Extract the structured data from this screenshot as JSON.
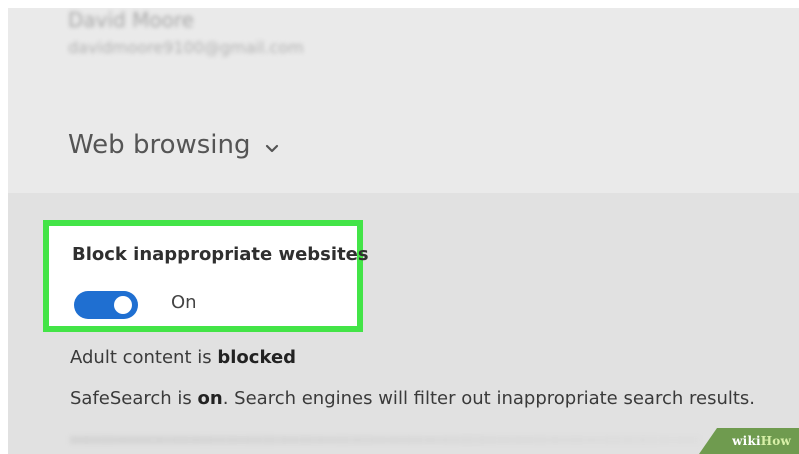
{
  "account": {
    "name": "David Moore",
    "email": "davidmoore9100@gmail.com"
  },
  "web_browsing": {
    "title": "Web browsing",
    "chevron_icon": "chevron-down-icon",
    "setting": {
      "title": "Block inappropriate websites",
      "toggle_state": "On",
      "toggle_color": "#1f6fd1",
      "highlight_color": "#43e447"
    },
    "status": {
      "prefix": "Adult content is ",
      "value": "blocked"
    },
    "safesearch": {
      "prefix": "SafeSearch is ",
      "value": "on",
      "suffix": ". Search engines will filter out inappropriate search results."
    }
  },
  "watermark": {
    "wiki": "wiki",
    "how": "How"
  }
}
